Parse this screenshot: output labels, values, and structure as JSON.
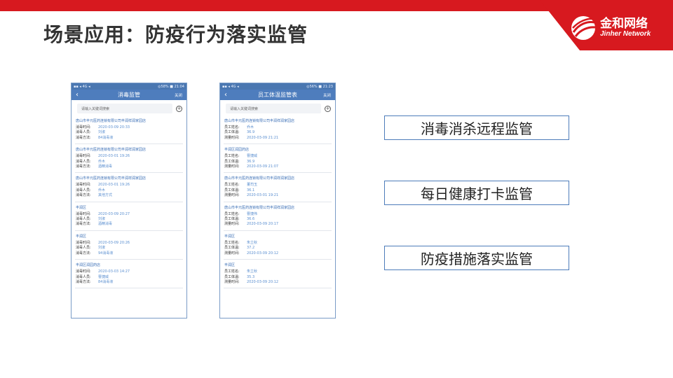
{
  "title": "场景应用：防疫行为落实监管",
  "brand": {
    "cn": "金和网络",
    "en": "Jinher Network",
    "color": "#d7191f"
  },
  "phone1": {
    "status_left": "▪▪ ◂ 4G ◂",
    "status_right": "◎58% ■ 21:04",
    "nav_title": "消毒监管",
    "close_label": "关闭",
    "search_placeholder": "请输入关键词搜索",
    "add_icon": "plus-circle-icon",
    "records": [
      {
        "title": "唐山市丰元医药连锁有限公司丰润祥润家园店",
        "rows": [
          {
            "label": "消毒时间:",
            "value": "2020-03-09 20:33"
          },
          {
            "label": "消毒人员:",
            "value": "刘淑"
          },
          {
            "label": "消毒方法:",
            "value": "84消毒液"
          }
        ]
      },
      {
        "title": "唐山市丰元医药连锁有限公司丰润祥润家园店",
        "rows": [
          {
            "label": "消毒时间:",
            "value": "2020-03-01 19:26"
          },
          {
            "label": "消毒人员:",
            "value": "乔木"
          },
          {
            "label": "消毒方法:",
            "value": "酒精消毒"
          }
        ]
      },
      {
        "title": "唐山市丰元医药连锁有限公司丰润祥润家园店",
        "rows": [
          {
            "label": "消毒时间:",
            "value": "2020-03-01 19:26"
          },
          {
            "label": "消毒人员:",
            "value": "乔木"
          },
          {
            "label": "消毒方法:",
            "value": "其他方式"
          }
        ]
      },
      {
        "title": "丰润区",
        "rows": [
          {
            "label": "消毒时间:",
            "value": "2020-03-09 20:27"
          },
          {
            "label": "消毒人员:",
            "value": "刘淑"
          },
          {
            "label": "消毒方法:",
            "value": "酒精消毒"
          }
        ]
      },
      {
        "title": "丰润区",
        "rows": [
          {
            "label": "消毒时间:",
            "value": "2020-03-09 20:26"
          },
          {
            "label": "消毒人员:",
            "value": "刘淑"
          },
          {
            "label": "消毒方法:",
            "value": "94消毒液"
          }
        ]
      },
      {
        "title": "丰润区润园药店",
        "rows": [
          {
            "label": "消毒时间:",
            "value": "2020-03-03 14:27"
          },
          {
            "label": "消毒人员:",
            "value": "曹捷威"
          },
          {
            "label": "消毒方法:",
            "value": "84消毒液"
          }
        ]
      }
    ]
  },
  "phone2": {
    "status_left": "▪▪ ◂ 4G ◂",
    "status_right": "◎56% ■ 21:23",
    "nav_title": "员工体温监管表",
    "close_label": "关闭",
    "search_placeholder": "请输入关键词搜索",
    "add_icon": "plus-circle-icon",
    "records": [
      {
        "title": "唐山市丰元医药连锁有限公司丰润祥润家园店",
        "rows": [
          {
            "label": "员工姓名:",
            "value": "乔木"
          },
          {
            "label": "员工体温:",
            "value": "36.9"
          },
          {
            "label": "测量时间:",
            "value": "2020-03-09 21:21"
          }
        ]
      },
      {
        "title": "丰润区润园药店",
        "rows": [
          {
            "label": "员工姓名:",
            "value": "曹捷威"
          },
          {
            "label": "员工体温:",
            "value": "36.9"
          },
          {
            "label": "测量时间:",
            "value": "2020-03-09 21:07"
          }
        ]
      },
      {
        "title": "唐山市丰元医药连锁有限公司丰润祥润家园店",
        "rows": [
          {
            "label": "员工姓名:",
            "value": "董司玉"
          },
          {
            "label": "员工体温:",
            "value": "36.1"
          },
          {
            "label": "测量时间:",
            "value": "2020-03-01 19:21"
          }
        ]
      },
      {
        "title": "唐山市丰元医药连锁有限公司丰润祥润家园店",
        "rows": [
          {
            "label": "员工姓名:",
            "value": "曹捷伟"
          },
          {
            "label": "员工体温:",
            "value": "36.6"
          },
          {
            "label": "测量时间:",
            "value": "2020-03-09 20:17"
          }
        ]
      },
      {
        "title": "丰润区",
        "rows": [
          {
            "label": "员工姓名:",
            "value": "朱立秋"
          },
          {
            "label": "员工体温:",
            "value": "37.2"
          },
          {
            "label": "测量时间:",
            "value": "2020-03-09 20:12"
          }
        ]
      },
      {
        "title": "丰润区",
        "rows": [
          {
            "label": "员工姓名:",
            "value": "朱立秋"
          },
          {
            "label": "员工体温:",
            "value": "35.3"
          },
          {
            "label": "测量时间:",
            "value": "2020-03-09 20:12"
          }
        ]
      }
    ]
  },
  "tags": [
    "消毒消杀远程监管",
    "每日健康打卡监管",
    "防疫措施落实监管"
  ]
}
